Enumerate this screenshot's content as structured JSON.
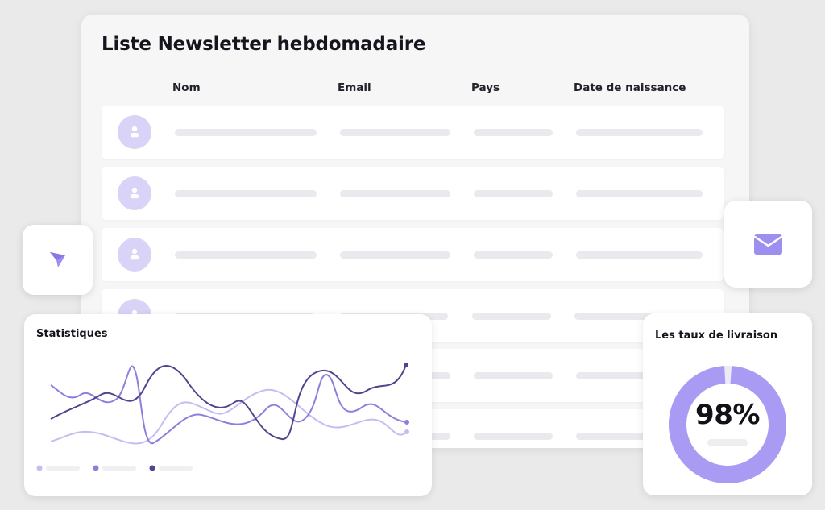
{
  "newsletter": {
    "title": "Liste Newsletter hebdomadaire",
    "columns": [
      "Nom",
      "Email",
      "Pays",
      "Date de naissance"
    ],
    "rows": 6
  },
  "icons": {
    "send": "paper-plane-icon",
    "mail": "envelope-icon",
    "user": "user-icon"
  },
  "stats": {
    "title": "Statistiques"
  },
  "delivery": {
    "title": "Les taux de livraison",
    "value_label": "98%",
    "percent": 98
  },
  "colors": {
    "accent_light": "#c5bcf2",
    "accent_mid": "#8f7fdc",
    "accent_dark": "#53448f",
    "donut": "#a99bf3",
    "avatar_bg": "#d9d3f7"
  }
}
